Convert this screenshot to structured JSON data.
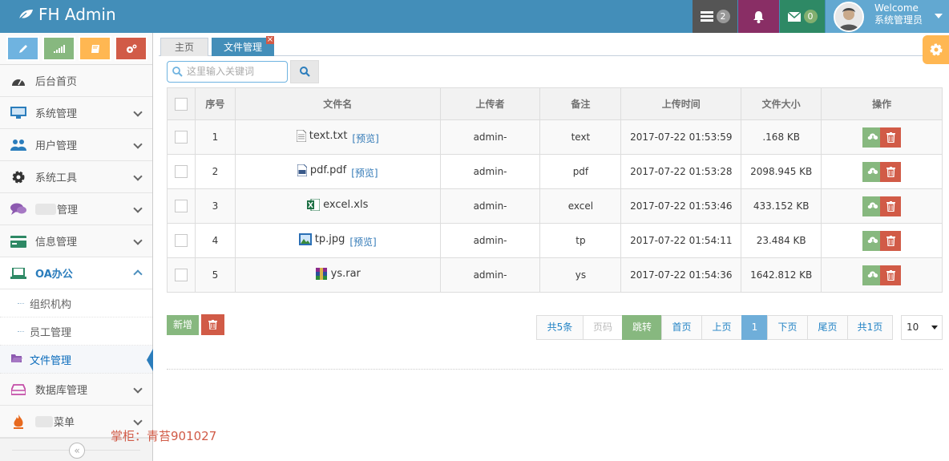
{
  "brand": {
    "title": "FH Admin"
  },
  "navbar": {
    "tasks_count": "2",
    "messages_count": "0",
    "welcome": "Welcome",
    "username": "系统管理员"
  },
  "sidebar": {
    "items": [
      {
        "label": "后台首页",
        "icon": "dashboard-icon"
      },
      {
        "label": "系统管理",
        "icon": "desktop-icon"
      },
      {
        "label": "用户管理",
        "icon": "users-icon"
      },
      {
        "label": "系统工具",
        "icon": "cog-icon"
      },
      {
        "label": "管理",
        "icon": "comments-icon"
      },
      {
        "label": "信息管理",
        "icon": "credit-card-icon"
      },
      {
        "label": "OA办公",
        "icon": "laptop-icon"
      },
      {
        "label": "数据库管理",
        "icon": "hdd-icon"
      },
      {
        "label": "菜单",
        "icon": "fire-icon"
      }
    ],
    "oa_submenu": [
      "组织机构",
      "员工管理",
      "文件管理"
    ],
    "collapse_glyph": "«"
  },
  "watermark": "掌柜：青苔901027",
  "tabs": {
    "home": "主页",
    "file": "文件管理",
    "close": "×"
  },
  "search": {
    "placeholder": "这里输入关键词"
  },
  "table": {
    "headers": [
      "序号",
      "文件名",
      "上传者",
      "备注",
      "上传时间",
      "文件大小",
      "操作"
    ],
    "preview_label": "[预览]",
    "rows": [
      {
        "no": "1",
        "name": "text.txt",
        "preview": true,
        "uploader": "admin-",
        "note": "text",
        "time": "2017-07-22 01:53:59",
        "size": ".168 KB",
        "icon": "txt-file-icon"
      },
      {
        "no": "2",
        "name": "pdf.pdf",
        "preview": true,
        "uploader": "admin-",
        "note": "pdf",
        "time": "2017-07-22 01:53:28",
        "size": "2098.945 KB",
        "icon": "pdf-file-icon"
      },
      {
        "no": "3",
        "name": "excel.xls",
        "preview": false,
        "uploader": "admin-",
        "note": "excel",
        "time": "2017-07-22 01:53:46",
        "size": "433.152 KB",
        "icon": "excel-file-icon"
      },
      {
        "no": "4",
        "name": "tp.jpg",
        "preview": true,
        "uploader": "admin-",
        "note": "tp",
        "time": "2017-07-22 01:54:11",
        "size": "23.484 KB",
        "icon": "image-file-icon"
      },
      {
        "no": "5",
        "name": "ys.rar",
        "preview": false,
        "uploader": "admin-",
        "note": "ys",
        "time": "2017-07-22 01:54:36",
        "size": "1642.812 KB",
        "icon": "rar-file-icon"
      }
    ]
  },
  "actions": {
    "add": "新增"
  },
  "pager": {
    "total": "共5条",
    "page_input_placeholder": "页码",
    "jump": "跳转",
    "first": "首页",
    "prev": "上页",
    "current": "1",
    "next": "下页",
    "last": "尾页",
    "pages": "共1页",
    "page_size": "10"
  },
  "colors": {
    "primary": "#438eb9",
    "success": "#87b87f",
    "danger": "#d15b47",
    "warning": "#ffb752"
  }
}
